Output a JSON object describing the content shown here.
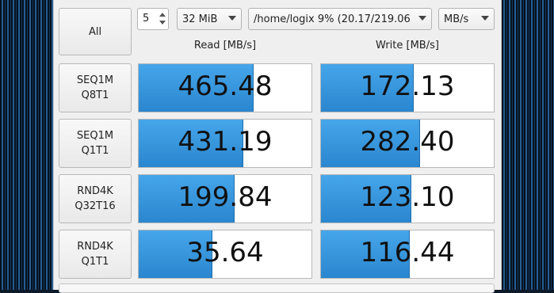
{
  "toolbar": {
    "all_label": "All",
    "count": "5",
    "size": "32 MiB",
    "target": "/home/logix 9% (20.17/219.06",
    "unit": "MB/s"
  },
  "headers": {
    "read": "Read [MB/s]",
    "write": "Write [MB/s]"
  },
  "tests": [
    {
      "label_line1": "SEQ1M",
      "label_line2": "Q8T1",
      "read": "465.48",
      "read_fill": 0.66,
      "write": "172.13",
      "write_fill": 0.53
    },
    {
      "label_line1": "SEQ1M",
      "label_line2": "Q1T1",
      "read": "431.19",
      "read_fill": 0.6,
      "write": "282.40",
      "write_fill": 0.57
    },
    {
      "label_line1": "RND4K",
      "label_line2": "Q32T16",
      "read": "199.84",
      "read_fill": 0.55,
      "write": "123.10",
      "write_fill": 0.52
    },
    {
      "label_line1": "RND4K",
      "label_line2": "Q1T1",
      "read": "35.64",
      "read_fill": 0.42,
      "write": "116.44",
      "write_fill": 0.51
    }
  ]
}
